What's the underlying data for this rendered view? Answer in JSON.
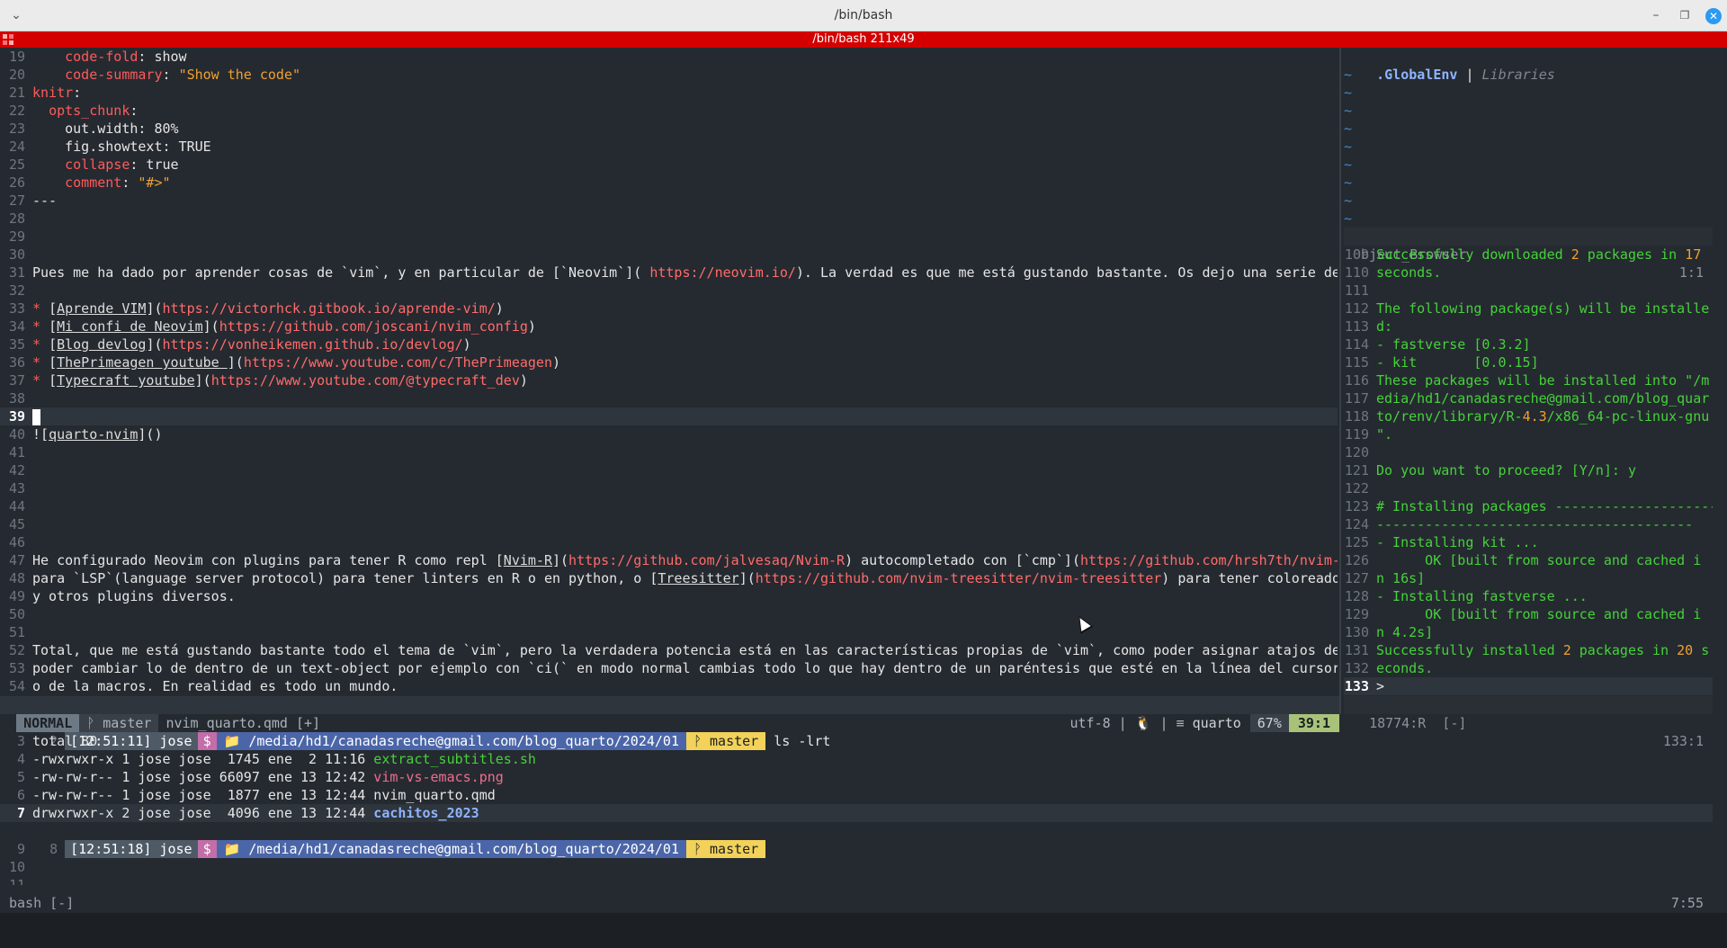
{
  "window": {
    "title": "/bin/bash",
    "subtitle": "/bin/bash 211x49"
  },
  "editor": {
    "lines": [
      {
        "n": "19",
        "parts": [
          [
            "t",
            "    "
          ],
          [
            "red",
            "code-fold"
          ],
          [
            "t",
            ": show"
          ]
        ]
      },
      {
        "n": "20",
        "parts": [
          [
            "t",
            "    "
          ],
          [
            "red",
            "code-summary"
          ],
          [
            "t",
            ": "
          ],
          [
            "org",
            "\"Show the code\""
          ]
        ]
      },
      {
        "n": "21",
        "parts": [
          [
            "red",
            "knitr"
          ],
          [
            "t",
            ":"
          ]
        ]
      },
      {
        "n": "22",
        "parts": [
          [
            "t",
            "  "
          ],
          [
            "red",
            "opts_chunk"
          ],
          [
            "t",
            ":"
          ]
        ]
      },
      {
        "n": "23",
        "parts": [
          [
            "t",
            "    out.width: 80%"
          ]
        ]
      },
      {
        "n": "24",
        "parts": [
          [
            "t",
            "    fig.showtext: TRUE"
          ]
        ]
      },
      {
        "n": "25",
        "parts": [
          [
            "t",
            "    "
          ],
          [
            "red",
            "collapse"
          ],
          [
            "t",
            ": true"
          ]
        ]
      },
      {
        "n": "26",
        "parts": [
          [
            "t",
            "    "
          ],
          [
            "red",
            "comment"
          ],
          [
            "t",
            ": "
          ],
          [
            "org",
            "\"#>\""
          ]
        ]
      },
      {
        "n": "27",
        "parts": [
          [
            "t",
            "---"
          ]
        ]
      },
      {
        "n": "28",
        "parts": []
      },
      {
        "n": "29",
        "parts": []
      },
      {
        "n": "30",
        "parts": []
      },
      {
        "n": "31",
        "parts": [
          [
            "t",
            "Pues me ha dado por aprender cosas de `vim`, y en particular de [`Neovim`]( "
          ],
          [
            "lnk",
            "https://neovim.io/"
          ],
          [
            "t",
            "). La verdad es que me está gustando bastante. Os dejo una serie de"
          ]
        ]
      },
      {
        "n": "32",
        "parts": []
      },
      {
        "n": "33",
        "parts": [
          [
            "red",
            "* "
          ],
          [
            "t",
            "["
          ],
          [
            "ul",
            "Aprende VIM"
          ],
          [
            "t",
            "]("
          ],
          [
            "lnk",
            "https://victorhck.gitbook.io/aprende-vim/"
          ],
          [
            "t",
            ")"
          ]
        ]
      },
      {
        "n": "34",
        "parts": [
          [
            "red",
            "* "
          ],
          [
            "t",
            "["
          ],
          [
            "ul",
            "Mi confi de Neovim"
          ],
          [
            "t",
            "]("
          ],
          [
            "lnk",
            "https://github.com/joscani/nvim_config"
          ],
          [
            "t",
            ")"
          ]
        ]
      },
      {
        "n": "35",
        "parts": [
          [
            "red",
            "* "
          ],
          [
            "t",
            "["
          ],
          [
            "ul",
            "Blog devlog"
          ],
          [
            "t",
            "]("
          ],
          [
            "lnk",
            "https://vonheikemen.github.io/devlog/"
          ],
          [
            "t",
            ")"
          ]
        ]
      },
      {
        "n": "36",
        "parts": [
          [
            "red",
            "* "
          ],
          [
            "t",
            "["
          ],
          [
            "ul",
            "ThePrimeagen youtube "
          ],
          [
            "t",
            "]("
          ],
          [
            "lnk",
            "https://www.youtube.com/c/ThePrimeagen"
          ],
          [
            "t",
            ")"
          ]
        ]
      },
      {
        "n": "37",
        "parts": [
          [
            "red",
            "* "
          ],
          [
            "t",
            "["
          ],
          [
            "ul",
            "Typecraft youtube"
          ],
          [
            "t",
            "]("
          ],
          [
            "lnk",
            "https://www.youtube.com/@typecraft_dev"
          ],
          [
            "t",
            ")"
          ]
        ]
      },
      {
        "n": "38",
        "parts": []
      },
      {
        "n": "39",
        "parts": [],
        "current": true
      },
      {
        "n": "40",
        "parts": [
          [
            "t",
            "!["
          ],
          [
            "ul",
            "quarto-nvim"
          ],
          [
            "t",
            "]()"
          ]
        ]
      },
      {
        "n": "41",
        "parts": []
      },
      {
        "n": "42",
        "parts": []
      },
      {
        "n": "43",
        "parts": []
      },
      {
        "n": "44",
        "parts": []
      },
      {
        "n": "45",
        "parts": []
      },
      {
        "n": "46",
        "parts": []
      },
      {
        "n": "47",
        "parts": [
          [
            "t",
            "He configurado Neovim con plugins para tener R como repl ["
          ],
          [
            "ul",
            "Nvim-R"
          ],
          [
            "t",
            "]("
          ],
          [
            "lnk",
            "https://github.com/jalvesaq/Nvim-R"
          ],
          [
            "t",
            ") autocompletado con [`cmp`]("
          ],
          [
            "lnk",
            "https://github.com/hrsh7th/nvim-"
          ]
        ]
      },
      {
        "n": "48",
        "parts": [
          [
            "t",
            "para `LSP`(language server protocol) para tener linters en R o en python, o ["
          ],
          [
            "ul",
            "Treesitter"
          ],
          [
            "t",
            "]("
          ],
          [
            "lnk",
            "https://github.com/nvim-treesitter/nvim-treesitter"
          ],
          [
            "t",
            ") para tener coloreado"
          ]
        ]
      },
      {
        "n": "49",
        "parts": [
          [
            "t",
            "y otros plugins diversos."
          ]
        ]
      },
      {
        "n": "50",
        "parts": []
      },
      {
        "n": "51",
        "parts": []
      },
      {
        "n": "52",
        "parts": [
          [
            "t",
            "Total, que me está gustando bastante todo el tema de `vim`, pero la verdadera potencia está en las características propias de `vim`, como poder asignar atajos de"
          ]
        ]
      },
      {
        "n": "53",
        "parts": [
          [
            "t",
            "poder cambiar lo de dentro de un text-object por ejemplo con `ci(` en modo normal cambias todo lo que hay dentro de un paréntesis que esté en la línea del cursor"
          ]
        ]
      },
      {
        "n": "54",
        "parts": [
          [
            "t",
            "o de la macros. En realidad es todo un mundo."
          ]
        ]
      }
    ],
    "status": {
      "mode": "NORMAL",
      "branch": "master",
      "file": "nvim_quarto.qmd [+]",
      "encoding": "utf-8",
      "filetype": "quarto",
      "percent": "67%",
      "position": "39:1"
    }
  },
  "rpane": {
    "header_env": ".GlobalEnv",
    "header_sep": "|",
    "header_libs": "Libraries",
    "tildes": [
      "~",
      "~",
      "~",
      "~",
      "~",
      "~",
      "~",
      "~",
      "~"
    ],
    "ob_title": "Object_Browser",
    "ob_pos": "1:1",
    "console": [
      {
        "n": "109",
        "parts": [
          [
            "grn",
            "Successfully downloaded "
          ],
          [
            "org",
            "2"
          ],
          [
            "grn",
            " packages in "
          ],
          [
            "org",
            "17"
          ]
        ]
      },
      {
        "n": "110",
        "parts": [
          [
            "grn",
            "seconds."
          ]
        ]
      },
      {
        "n": "111",
        "parts": []
      },
      {
        "n": "112",
        "parts": [
          [
            "grn",
            "The following package(s) will be installe"
          ]
        ]
      },
      {
        "n": "113",
        "parts": [
          [
            "grn",
            "d:"
          ]
        ]
      },
      {
        "n": "114",
        "parts": [
          [
            "grn",
            "- fastverse "
          ],
          [
            "grn",
            "[0.3.2]"
          ]
        ]
      },
      {
        "n": "115",
        "parts": [
          [
            "grn",
            "- kit       "
          ],
          [
            "grn",
            "[0.0.15]"
          ]
        ]
      },
      {
        "n": "116",
        "parts": [
          [
            "grn",
            "These packages will be installed into \"/m"
          ]
        ]
      },
      {
        "n": "117",
        "parts": [
          [
            "grn",
            "edia/hd1/canadasreche@gmail.com/blog_quar"
          ]
        ]
      },
      {
        "n": "118",
        "parts": [
          [
            "grn",
            "to/renv/library/R-"
          ],
          [
            "org",
            "4.3"
          ],
          [
            "grn",
            "/x86_64-pc-linux-gnu"
          ]
        ]
      },
      {
        "n": "119",
        "parts": [
          [
            "grn",
            "\"."
          ]
        ]
      },
      {
        "n": "120",
        "parts": []
      },
      {
        "n": "121",
        "parts": [
          [
            "grn",
            "Do you want to proceed? [Y/n]: y"
          ]
        ]
      },
      {
        "n": "122",
        "parts": []
      },
      {
        "n": "123",
        "parts": [
          [
            "grn",
            "# Installing packages --------------------"
          ]
        ]
      },
      {
        "n": "124",
        "parts": [
          [
            "grn",
            "---------------------------------------"
          ]
        ]
      },
      {
        "n": "125",
        "parts": [
          [
            "grn",
            "- Installing kit ..."
          ]
        ]
      },
      {
        "n": "126",
        "parts": [
          [
            "grn",
            "      OK [built from source and cached i"
          ]
        ]
      },
      {
        "n": "127",
        "parts": [
          [
            "grn",
            "n 16s]"
          ]
        ]
      },
      {
        "n": "128",
        "parts": [
          [
            "grn",
            "- Installing fastverse ..."
          ]
        ]
      },
      {
        "n": "129",
        "parts": [
          [
            "grn",
            "      OK [built from source and cached i"
          ]
        ]
      },
      {
        "n": "130",
        "parts": [
          [
            "grn",
            "n 4.2s]"
          ]
        ]
      },
      {
        "n": "131",
        "parts": [
          [
            "grn",
            "Successfully installed "
          ],
          [
            "org",
            "2"
          ],
          [
            "grn",
            " packages in "
          ],
          [
            "org",
            "20"
          ],
          [
            "grn",
            " s"
          ]
        ]
      },
      {
        "n": "132",
        "parts": [
          [
            "grn",
            "econds."
          ]
        ]
      },
      {
        "n": "133",
        "parts": [
          [
            "t",
            "> "
          ]
        ],
        "current": true
      }
    ],
    "status_left": "18774:R  [-]",
    "status_right": "133:1"
  },
  "terminal": {
    "prompt1": {
      "n": "2",
      "time": "[12:51:11] jose",
      "dollar": "$",
      "path": "/media/hd1/canadasreche@gmail.com/blog_quarto/2024/01",
      "branch": "master",
      "cmd": "ls -lrt"
    },
    "lines": [
      {
        "n": "3",
        "parts": [
          [
            "t",
            "total 80"
          ]
        ]
      },
      {
        "n": "4",
        "parts": [
          [
            "t",
            "-rwxrwxr-x 1 jose jose  1745 ene  2 11:16 "
          ],
          [
            "grn",
            "extract_subtitles.sh"
          ]
        ]
      },
      {
        "n": "5",
        "parts": [
          [
            "t",
            "-rw-rw-r-- 1 jose jose 66097 ene 13 12:42 "
          ],
          [
            "pink",
            "vim-vs-emacs.png"
          ]
        ]
      },
      {
        "n": "6",
        "parts": [
          [
            "t",
            "-rw-rw-r-- 1 jose jose  1877 ene 13 12:44 nvim_quarto.qmd"
          ]
        ]
      },
      {
        "n": "7",
        "parts": [
          [
            "t",
            "drwxrwxr-x 2 jose jose  4096 ene 13 12:44 "
          ],
          [
            "blu",
            "cachitos_2023"
          ]
        ],
        "current": true
      }
    ],
    "prompt2": {
      "n": "8",
      "time": "[12:51:18] jose",
      "dollar": "$",
      "path": "/media/hd1/canadasreche@gmail.com/blog_quarto/2024/01",
      "branch": "master"
    },
    "empty": [
      "9",
      "10",
      "11"
    ]
  },
  "tmux": {
    "left": "bash [-]",
    "right": "7:55"
  },
  "icons": {
    "collapse": "chevron-down-icon",
    "minimize": "minimize-icon",
    "restore": "restore-icon",
    "close": "close-icon"
  }
}
